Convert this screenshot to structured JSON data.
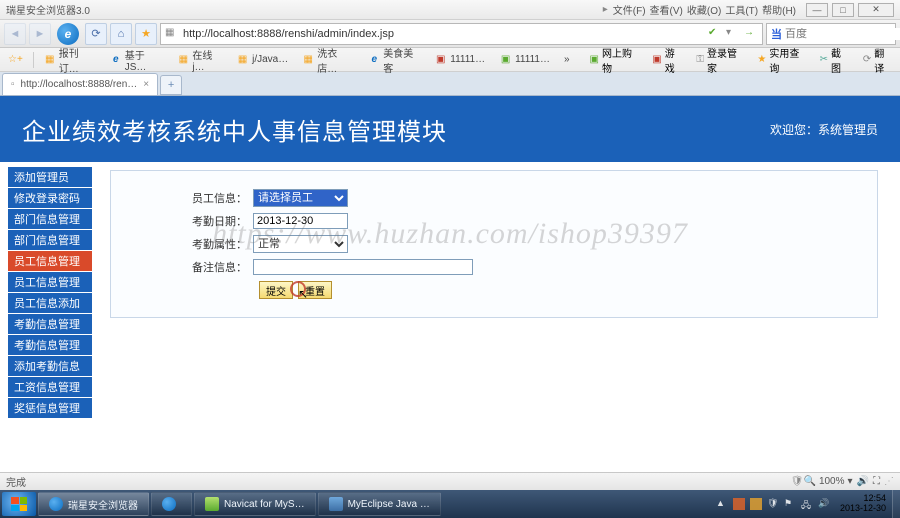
{
  "titlebar": {
    "app": "瑞星安全浏览器3.0",
    "menus": [
      "文件(F)",
      "查看(V)",
      "收藏(O)",
      "工具(T)",
      "帮助(H)"
    ]
  },
  "addr": {
    "url": "http://localhost:8888/renshi/admin/index.jsp",
    "search_ph": "百度"
  },
  "bookmarks": {
    "items": [
      "报刊订…",
      "基于JS…",
      "在线j…",
      "j/Java…",
      "洗衣店…",
      "美食美客",
      "11111…",
      "11111…"
    ],
    "tools": [
      "网上购物",
      "游戏",
      "登录管家",
      "实用查询",
      "截图",
      "翻译"
    ]
  },
  "tabstrip": {
    "tab": "http://localhost:8888/ren…"
  },
  "banner": {
    "title": "企业绩效考核系统中人事信息管理模块",
    "welcome": "欢迎您：系统管理员"
  },
  "sidebar": {
    "items": [
      "添加管理员",
      "修改登录密码",
      "部门信息管理",
      "部门信息管理",
      "员工信息管理",
      "员工信息管理",
      "员工信息添加",
      "考勤信息管理",
      "考勤信息管理",
      "添加考勤信息",
      "工资信息管理",
      "奖惩信息管理"
    ],
    "active_index": 4
  },
  "form": {
    "labels": {
      "emp": "员工信息：",
      "date": "考勤日期：",
      "attr": "考勤属性：",
      "note": "备注信息："
    },
    "emp_option": "请选择员工",
    "date_value": "2013-12-30",
    "attr_option": "正常",
    "note_value": "",
    "submit": "提交",
    "reset": "重置"
  },
  "watermark": "https://www.huzhan.com/ishop39397",
  "status": {
    "text": "完成",
    "zoom": "100%"
  },
  "taskbar": {
    "tasks": [
      "瑞星安全浏览器",
      "",
      "Navicat for MyS…",
      "MyEclipse Java …"
    ],
    "clock": {
      "time": "12:54",
      "date": "2013-12-30"
    }
  }
}
